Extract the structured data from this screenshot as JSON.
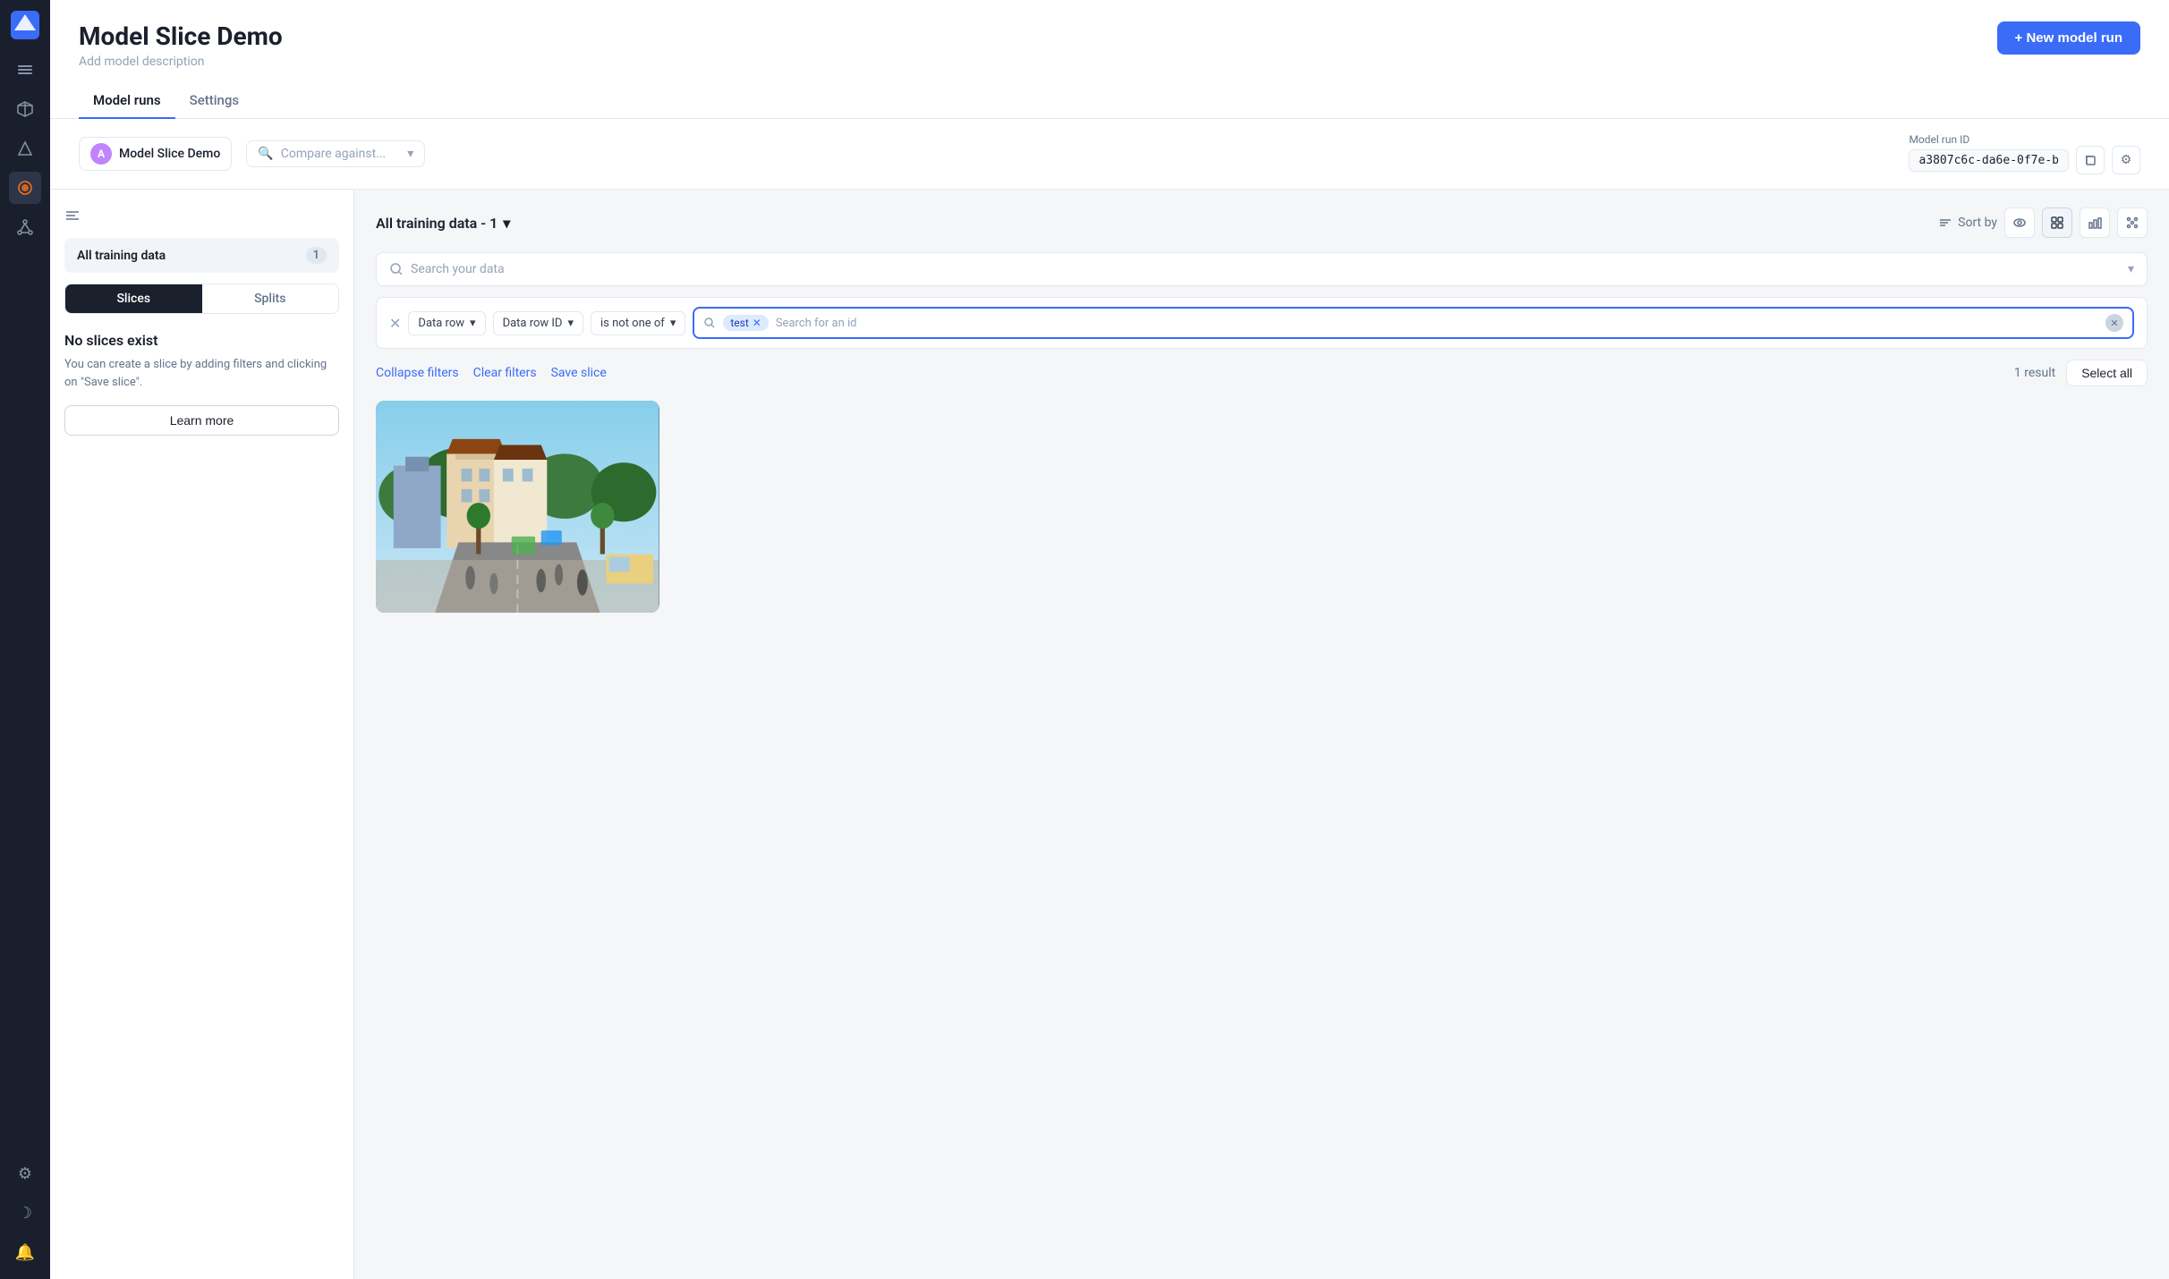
{
  "sidebar": {
    "icons": [
      {
        "name": "logo-icon",
        "symbol": "◈",
        "active": false
      },
      {
        "name": "layers-icon",
        "symbol": "⊞",
        "active": false
      },
      {
        "name": "cube-icon",
        "symbol": "❖",
        "active": false
      },
      {
        "name": "chart-icon",
        "symbol": "△",
        "active": false
      },
      {
        "name": "target-icon",
        "symbol": "◎",
        "active": true
      },
      {
        "name": "nodes-icon",
        "symbol": "⬡",
        "active": false
      }
    ],
    "bottom_icons": [
      {
        "name": "settings-icon",
        "symbol": "⚙"
      },
      {
        "name": "moon-icon",
        "symbol": "☽"
      },
      {
        "name": "bell-icon",
        "symbol": "🔔"
      }
    ]
  },
  "header": {
    "title": "Model Slice Demo",
    "subtitle": "Add model description",
    "new_model_btn": "+ New model run",
    "tabs": [
      {
        "label": "Model runs",
        "active": true
      },
      {
        "label": "Settings",
        "active": false
      }
    ]
  },
  "model_run_bar": {
    "model_name": "Model Slice Demo",
    "model_avatar": "A",
    "compare_placeholder": "Compare against...",
    "model_run_id_label": "Model run ID",
    "model_run_id_value": "a3807c6c-da6e-0f7e-b"
  },
  "left_panel": {
    "all_training_label": "All training data",
    "all_training_count": "1",
    "slice_tab": "Slices",
    "split_tab": "Splits",
    "no_slices_title": "No slices exist",
    "no_slices_desc": "You can create a slice by adding filters and clicking on \"Save slice\".",
    "learn_more_btn": "Learn more"
  },
  "right_panel": {
    "data_title": "All training data - 1",
    "search_placeholder": "Search your data",
    "filter": {
      "field": "Data row",
      "condition_field": "Data row ID",
      "operator": "is not one of",
      "search_placeholder": "Search for an id",
      "tag": "test"
    },
    "collapse_filters": "Collapse filters",
    "clear_filters": "Clear filters",
    "save_slice": "Save slice",
    "results_count": "1 result",
    "select_all": "Select all",
    "sort_by": "Sort by"
  }
}
